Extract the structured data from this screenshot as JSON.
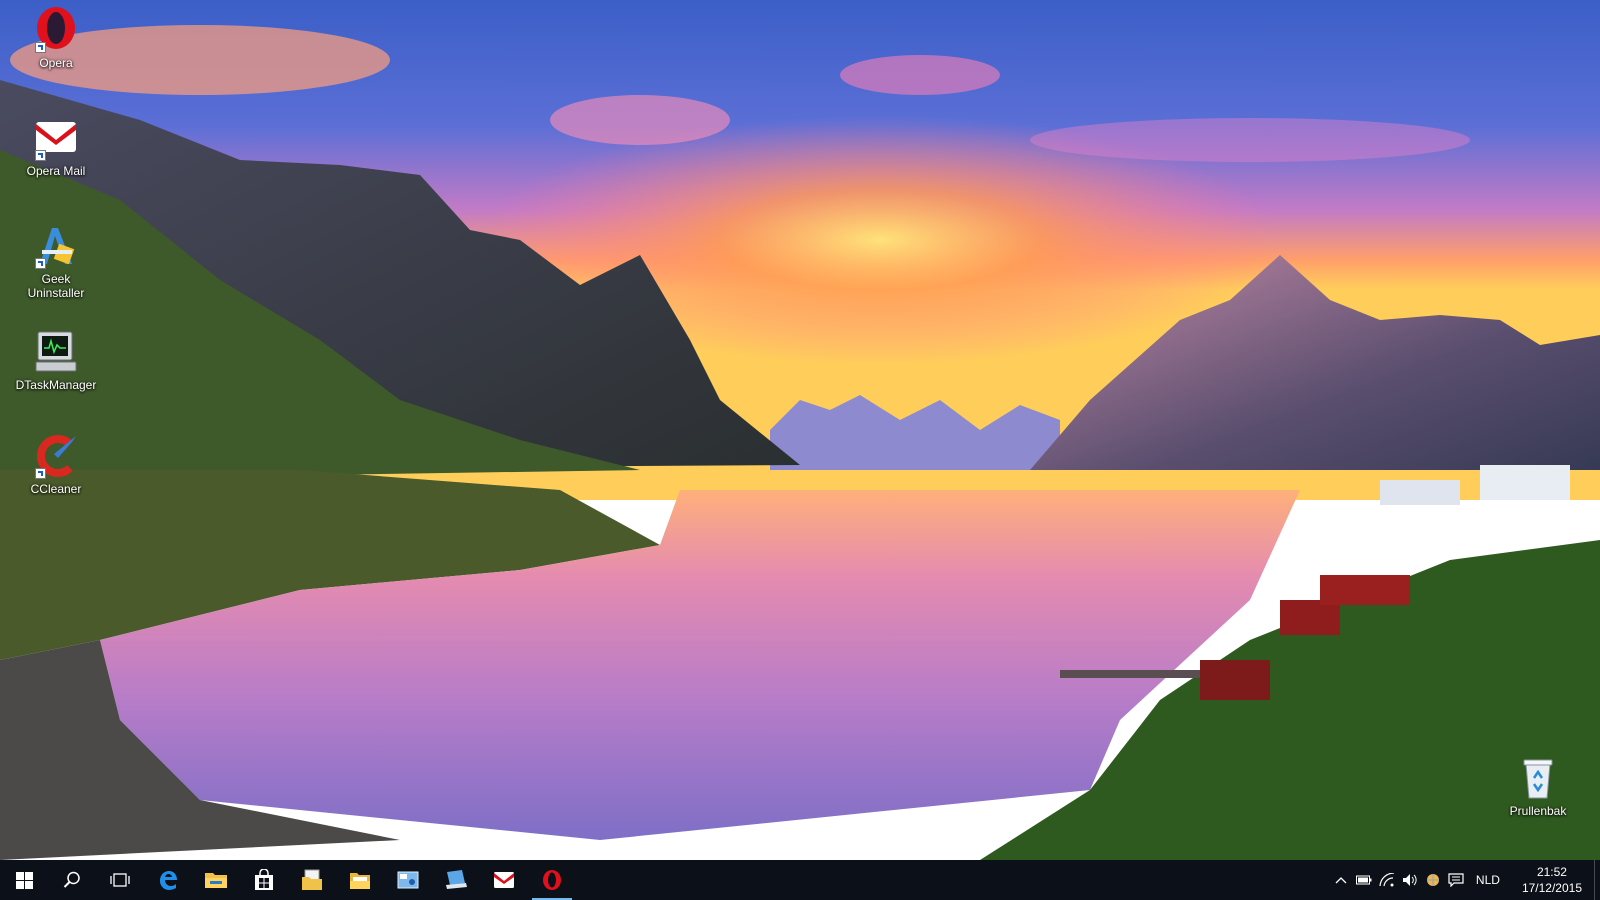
{
  "desktop": {
    "wallpaper": {
      "sky_top": "#3f63c9",
      "sky_glow": "#ff9b4a",
      "water": "#c77ab8"
    },
    "icons": [
      {
        "label": "Opera",
        "icon": "opera-icon",
        "shortcut": true
      },
      {
        "label": "Opera  Mail",
        "icon": "opera-mail-icon",
        "shortcut": true
      },
      {
        "label": "Geek Uninstaller",
        "icon": "geek-uninstaller-icon",
        "shortcut": true
      },
      {
        "label": "DTaskManager",
        "icon": "dtaskmanager-icon",
        "shortcut": false
      },
      {
        "label": "CCleaner",
        "icon": "ccleaner-icon",
        "shortcut": true
      }
    ],
    "recycle_bin": {
      "label": "Prullenbak",
      "icon": "recycle-bin-icon"
    }
  },
  "taskbar": {
    "background": "#0c1119",
    "accent": "#76b9ed",
    "pinned": [
      {
        "name": "start-button",
        "icon": "windows-logo-icon"
      },
      {
        "name": "search-button",
        "icon": "search-icon"
      },
      {
        "name": "task-view-button",
        "icon": "task-view-icon"
      },
      {
        "name": "edge-button",
        "icon": "edge-icon"
      },
      {
        "name": "file-explorer-button",
        "icon": "folder-icon"
      },
      {
        "name": "store-button",
        "icon": "store-icon"
      },
      {
        "name": "documents-button",
        "icon": "documents-folder-icon"
      },
      {
        "name": "files-button",
        "icon": "files-folder-icon"
      },
      {
        "name": "control-panel-button",
        "icon": "control-panel-icon"
      },
      {
        "name": "remote-desktop-button",
        "icon": "remote-desktop-icon"
      },
      {
        "name": "opera-mail-button",
        "icon": "mail-icon"
      },
      {
        "name": "opera-button",
        "icon": "opera-icon",
        "state": "active"
      }
    ],
    "tray": {
      "icons": [
        "chevron-up-icon",
        "battery-icon",
        "wifi-icon",
        "volume-icon",
        "network-globe-icon",
        "action-center-icon"
      ],
      "language": "NLD",
      "time": "21:52",
      "date": "17/12/2015"
    }
  }
}
